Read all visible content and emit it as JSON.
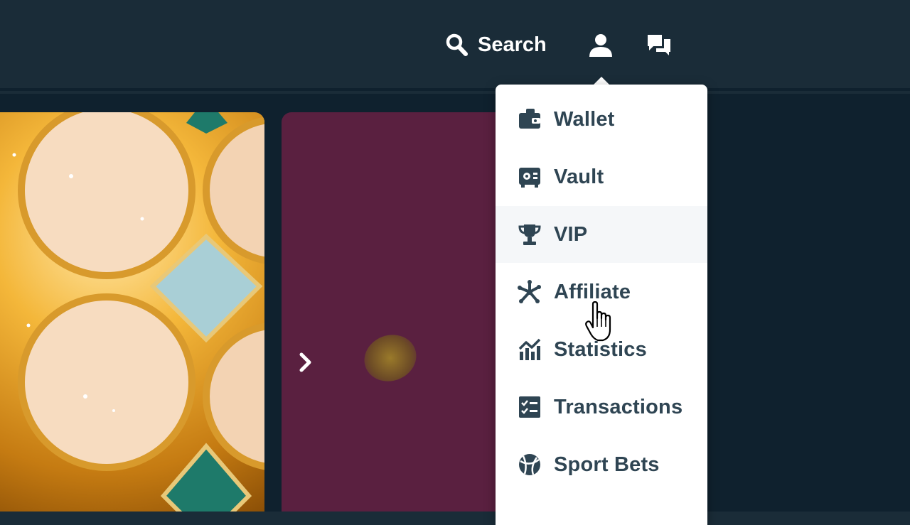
{
  "header": {
    "search_label": "Search",
    "search_icon": "search-icon",
    "user_icon": "user-icon",
    "chat_icon": "chat-icon"
  },
  "user_menu": {
    "items": [
      {
        "label": "Wallet",
        "icon": "wallet-icon"
      },
      {
        "label": "Vault",
        "icon": "vault-icon"
      },
      {
        "label": "VIP",
        "icon": "trophy-icon"
      },
      {
        "label": "Affiliate",
        "icon": "affiliate-icon"
      },
      {
        "label": "Statistics",
        "icon": "statistics-icon"
      },
      {
        "label": "Transactions",
        "icon": "transactions-icon"
      },
      {
        "label": "Sport Bets",
        "icon": "sport-bets-icon"
      }
    ]
  },
  "colors": {
    "header_bg": "#1a2c38",
    "content_bg": "#0f212e",
    "menu_text": "#2f4553",
    "promo_tile": "#5a2040"
  }
}
